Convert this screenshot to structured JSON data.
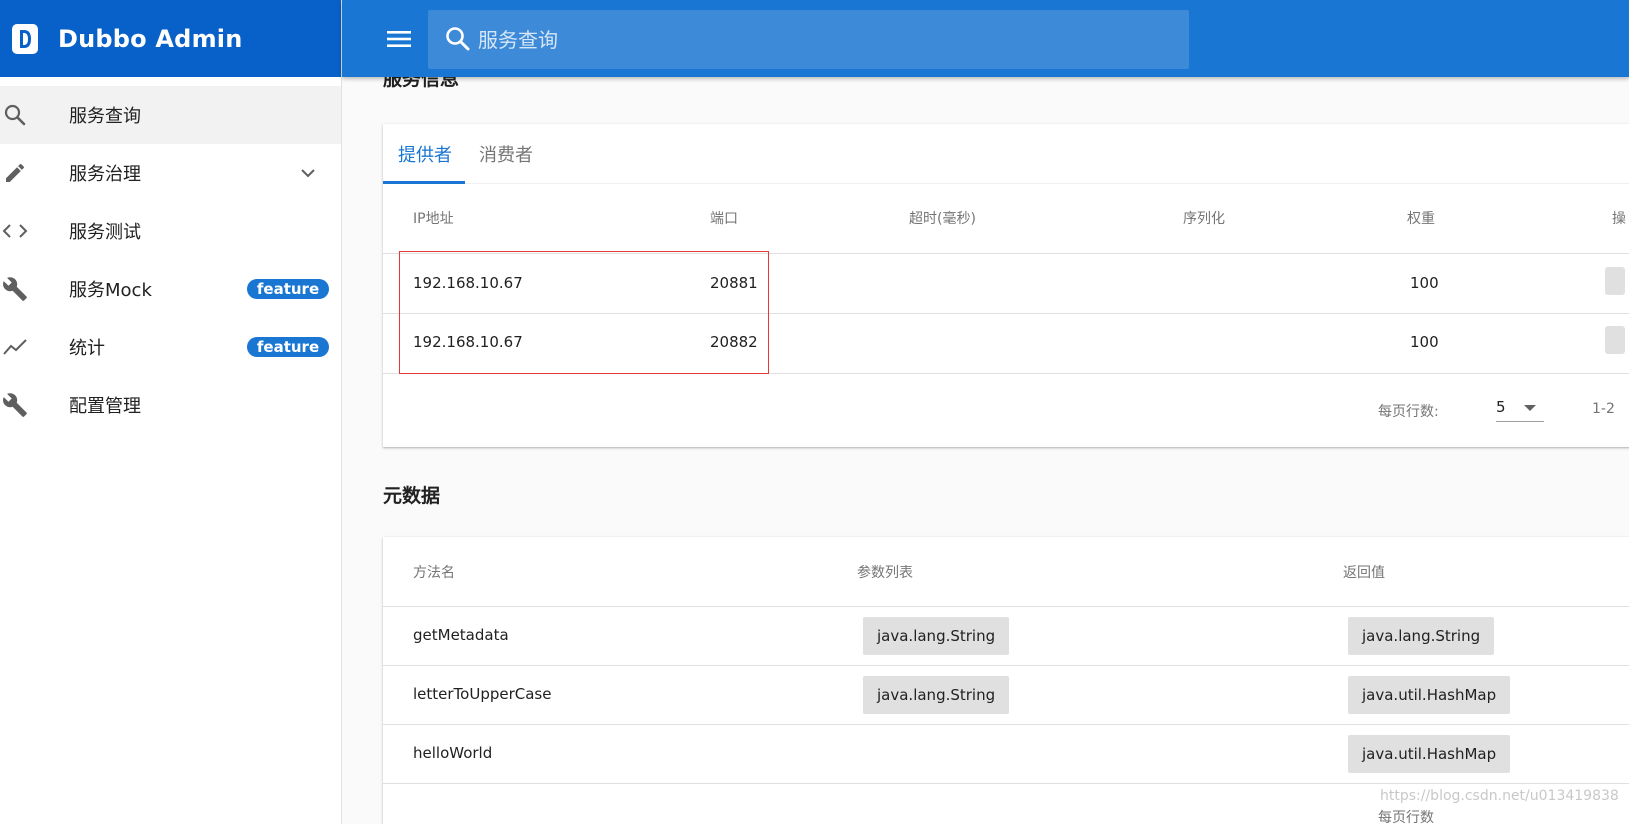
{
  "app": {
    "title": "Dubbo Admin",
    "brand_color": "#0860c9",
    "accent": "#1976d2"
  },
  "search": {
    "placeholder": "服务查询"
  },
  "sidebar": {
    "items": [
      {
        "label": "服务查询",
        "icon": "search-icon",
        "active": true
      },
      {
        "label": "服务治理",
        "icon": "pencil-icon",
        "expandable": true
      },
      {
        "label": "服务测试",
        "icon": "code-icon"
      },
      {
        "label": "服务Mock",
        "icon": "wrench-icon",
        "badge": "feature"
      },
      {
        "label": "统计",
        "icon": "trend-icon",
        "badge": "feature"
      },
      {
        "label": "配置管理",
        "icon": "wrench-icon"
      }
    ]
  },
  "service_info": {
    "title": "服务信息",
    "tabs": [
      {
        "label": "提供者",
        "active": true
      },
      {
        "label": "消费者"
      }
    ],
    "columns": [
      "IP地址",
      "端口",
      "超时(毫秒)",
      "序列化",
      "权重",
      "操"
    ],
    "rows": [
      {
        "ip": "192.168.10.67",
        "port": "20881",
        "timeout": "",
        "serialization": "",
        "weight": "100"
      },
      {
        "ip": "192.168.10.67",
        "port": "20882",
        "timeout": "",
        "serialization": "",
        "weight": "100"
      }
    ],
    "pager": {
      "rows_per_page_label": "每页行数:",
      "rows_per_page": "5",
      "range": "1-2"
    }
  },
  "metadata": {
    "title": "元数据",
    "columns": [
      "方法名",
      "参数列表",
      "返回值"
    ],
    "rows": [
      {
        "method": "getMetadata",
        "params": "java.lang.String",
        "returns": "java.lang.String"
      },
      {
        "method": "letterToUpperCase",
        "params": "java.lang.String",
        "returns": "java.util.HashMap"
      },
      {
        "method": "helloWorld",
        "params": "",
        "returns": "java.util.HashMap"
      }
    ],
    "pager_label_cut": "每页行数"
  },
  "watermark": "https://blog.csdn.net/u013419838"
}
